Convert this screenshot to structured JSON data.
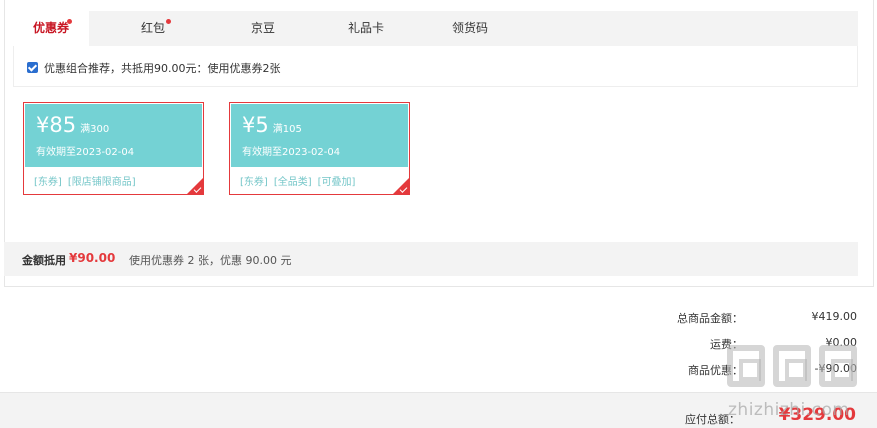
{
  "tabs": [
    {
      "label": "优惠券",
      "active": true,
      "dot": true
    },
    {
      "label": "红包",
      "active": false,
      "dot": true
    },
    {
      "label": "京豆",
      "active": false,
      "dot": false
    },
    {
      "label": "礼品卡",
      "active": false,
      "dot": false
    },
    {
      "label": "领货码",
      "active": false,
      "dot": false
    }
  ],
  "combo": {
    "checked": true,
    "text": "优惠组合推荐，共抵用90.00元：使用优惠券2张"
  },
  "coupons": [
    {
      "amount": "¥85",
      "condition": "满300",
      "expiry": "有效期至2023-02-04",
      "tags": [
        "[东券]",
        "[限店铺限商品]"
      ],
      "selected": true
    },
    {
      "amount": "¥5",
      "condition": "满105",
      "expiry": "有效期至2023-02-04",
      "tags": [
        "[东券]",
        "[全品类]",
        "[可叠加]"
      ],
      "selected": true
    }
  ],
  "amount_row": {
    "label": "金额抵用",
    "value": "¥90.00",
    "desc": "使用优惠券 2 张，优惠 90.00 元"
  },
  "summary": {
    "goods_label": "总商品金额：",
    "goods_value": "¥419.00",
    "shipping_label": "运费：",
    "shipping_value": "¥0.00",
    "discount_label": "商品优惠：",
    "discount_value": "-¥90.00",
    "pay_label": "应付总额：",
    "pay_value": "¥329.00"
  },
  "watermark": {
    "text": "zhizhizhi.com"
  },
  "colors": {
    "accent": "#e4393c",
    "coupon": "#74d2d4"
  }
}
